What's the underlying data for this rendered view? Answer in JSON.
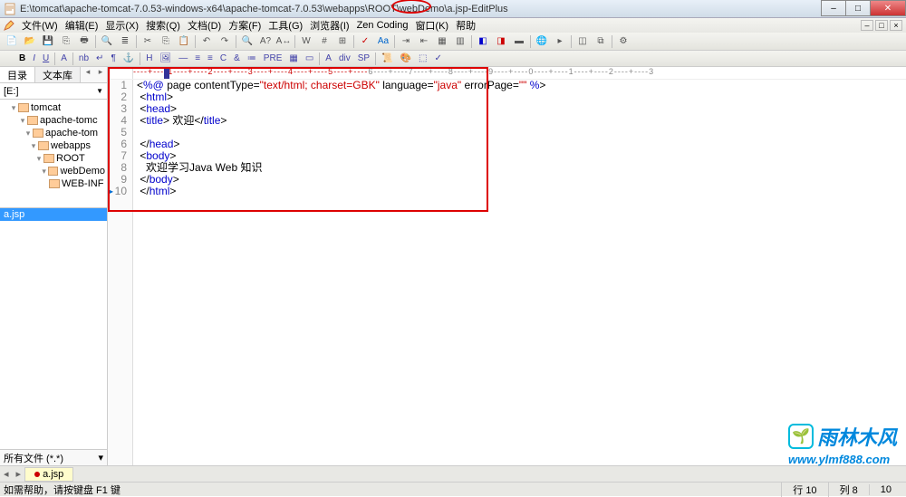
{
  "title": {
    "path": "E:\\tomcat\\apache-tomcat-7.0.53-windows-x64\\apache-tomcat-7.0.53\\webapps\\ROOT\\webDemo\\a.jsp",
    "app": "EditPlus"
  },
  "menus": [
    "文件(W)",
    "编辑(E)",
    "显示(X)",
    "搜索(Q)",
    "文档(D)",
    "方案(F)",
    "工具(G)",
    "浏览器(I)",
    "Zen Coding",
    "窗口(K)",
    "帮助"
  ],
  "sidebar": {
    "tabs": [
      "目录",
      "文本库"
    ],
    "drive": "[E:]",
    "tree": [
      {
        "depth": 1,
        "label": "tomcat",
        "exp": "▾"
      },
      {
        "depth": 2,
        "label": "apache-tomc",
        "exp": "▾"
      },
      {
        "depth": 3,
        "label": "apache-tom",
        "exp": "▾"
      },
      {
        "depth": 4,
        "label": "webapps",
        "exp": "▾"
      },
      {
        "depth": 5,
        "label": "ROOT",
        "exp": "▾"
      },
      {
        "depth": 6,
        "label": "webDemo",
        "exp": "▾"
      },
      {
        "depth": 6,
        "label": "WEB-INF",
        "exp": ""
      }
    ],
    "files": [
      "a.jsp"
    ],
    "filter": "所有文件 (*.*)"
  },
  "code": {
    "lines": [
      {
        "n": 1,
        "html": "&lt;<span class='kw'>%@</span> page contentType=<span class='str'>\"text/html; charset=GBK\"</span> language=<span class='str'>\"java\"</span> errorPage=<span class='str'>\"\"</span> <span class='kw'>%</span>&gt;"
      },
      {
        "n": 2,
        "html": " &lt;<span class='tag'>html</span>&gt;"
      },
      {
        "n": 3,
        "html": " &lt;<span class='tag'>head</span>&gt;"
      },
      {
        "n": 4,
        "html": " &lt;<span class='tag'>title</span>&gt; 欢迎&lt;/<span class='tag'>title</span>&gt;"
      },
      {
        "n": 5,
        "html": ""
      },
      {
        "n": 6,
        "html": " &lt;/<span class='tag'>head</span>&gt;"
      },
      {
        "n": 7,
        "html": " &lt;<span class='tag'>body</span>&gt;"
      },
      {
        "n": 8,
        "html": "   欢迎学习Java Web 知识"
      },
      {
        "n": 9,
        "html": " &lt;/<span class='tag'>body</span>&gt;"
      },
      {
        "n": 10,
        "html": " &lt;/<span class='tag'>html</span>&gt;",
        "marker": true
      }
    ]
  },
  "doc_tab": "a.jsp",
  "ruler": {
    "red": "----+----1----+----2----+----3----+----4----+----5----+----",
    "rest": "6----+----7----+----8----+----9----+----0----+----1----+----2----+----3"
  },
  "status": {
    "hint": "如需帮助，请按键盘 F1 键",
    "line_lbl": "行",
    "line": "10",
    "col_lbl": "列",
    "col": "8",
    "total": "10"
  },
  "watermark": {
    "brand": "雨林木风",
    "url": "www.ylmf888.com"
  }
}
